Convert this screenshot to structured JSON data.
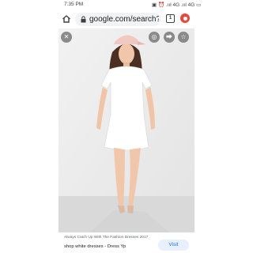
{
  "status_bar": {
    "time": "7:35 PM",
    "indicators": "▣ ⏰ .ııl 4G .ııl 4G ▭"
  },
  "browser": {
    "url": "google.com/search?c",
    "tab_count": "1",
    "menu_color": "#e34a3c",
    "icons": [
      "home-icon",
      "lock-icon",
      "tabs-icon",
      "menu-icon"
    ]
  },
  "image_viewer": {
    "close_icon": "✕",
    "lens_icon": "◎",
    "share_icon": "⮕",
    "save_icon": "☆",
    "photo_subject": "woman-in-white-tshirt-dress"
  },
  "result": {
    "site": "Always Catch Up With The Fashion Dresses 2017",
    "title": "shop white dresses - Dress Yp",
    "visit_label": "Visit",
    "accent_color": "#1a73e8"
  }
}
